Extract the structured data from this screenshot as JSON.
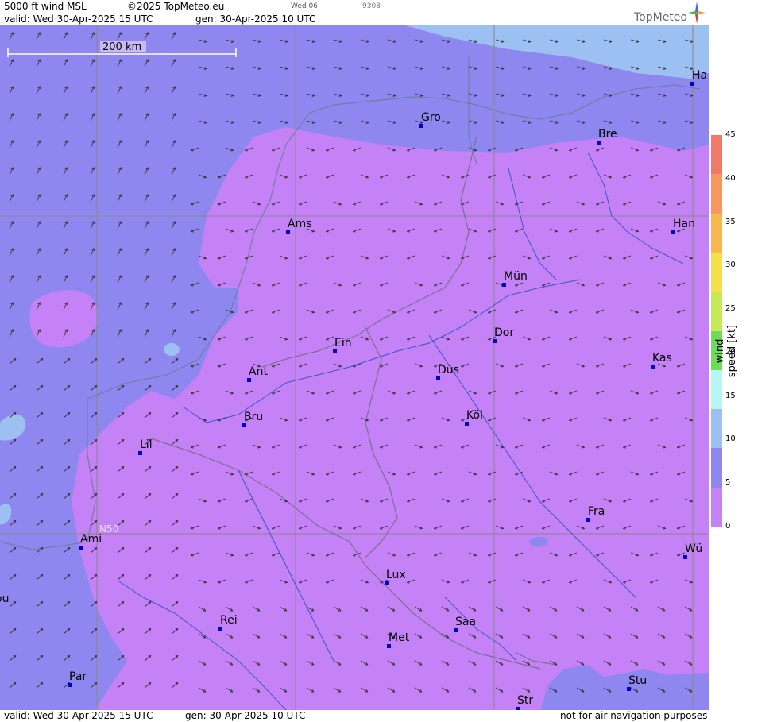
{
  "header": {
    "title": "5000 ft wind MSL",
    "copyright": "©2025 TopMeteo.eu",
    "small_day": "Wed 06",
    "small_code": "9308",
    "valid_line": "valid:  Wed  30-Apr-2025  15 UTC",
    "gen_line": "gen: 30-Apr-2025 10 UTC",
    "logo": "TopMeteo"
  },
  "footer": {
    "valid_line": "valid:  Wed  30-Apr-2025  15 UTC",
    "gen_line": "gen: 30-Apr-2025 10 UTC",
    "disclaimer": "not for air navigation purposes"
  },
  "map": {
    "scale_label": "200 km",
    "lat_label": "N50",
    "cities": [
      {
        "name": "Ha"
      },
      {
        "name": "Gro"
      },
      {
        "name": "Bre"
      },
      {
        "name": "Ams"
      },
      {
        "name": "Han"
      },
      {
        "name": "Mün"
      },
      {
        "name": "Ein"
      },
      {
        "name": "Dor"
      },
      {
        "name": "Ant"
      },
      {
        "name": "Kas"
      },
      {
        "name": "Düs"
      },
      {
        "name": "Bru"
      },
      {
        "name": "Köl"
      },
      {
        "name": "Lil"
      },
      {
        "name": "Fra"
      },
      {
        "name": "Ami"
      },
      {
        "name": "Wü"
      },
      {
        "name": "Lux"
      },
      {
        "name": "ou"
      },
      {
        "name": "Rei"
      },
      {
        "name": "Saa"
      },
      {
        "name": "Met"
      },
      {
        "name": "Par"
      },
      {
        "name": "Stu"
      },
      {
        "name": "Str"
      }
    ]
  },
  "legend": {
    "unit": "wind  speed  [kt]",
    "ticks": [
      "45",
      "40",
      "35",
      "30",
      "25",
      "20",
      "15",
      "10",
      "5",
      "0"
    ],
    "colors": [
      "#f07a6a",
      "#f5975e",
      "#f7b84f",
      "#f5e04c",
      "#c6ea55",
      "#6fdc59",
      "#b7f6f2",
      "#9cc0f2",
      "#8f87f0",
      "#c581f6"
    ]
  }
}
